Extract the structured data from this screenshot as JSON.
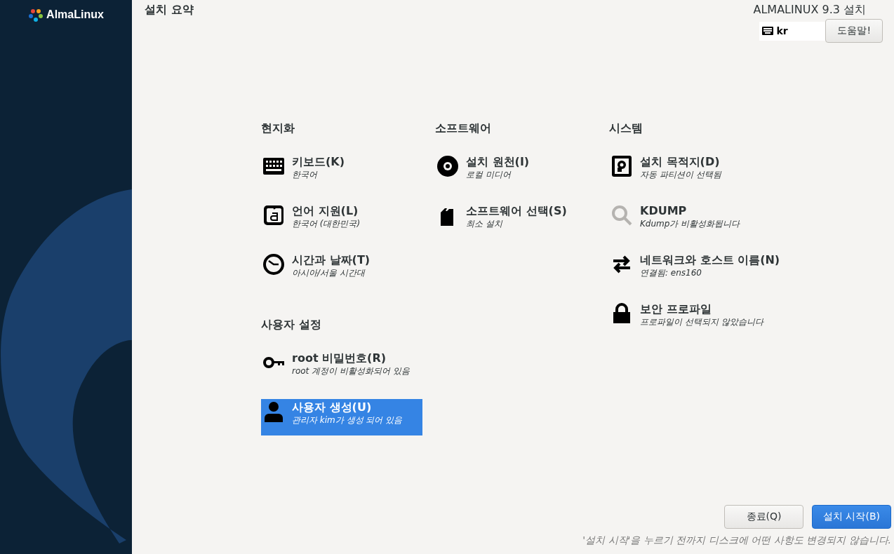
{
  "sidebar": {
    "logo_text": "AlmaLinux"
  },
  "header": {
    "title": "설치 요약",
    "product": "ALMALINUX 9.3 설치",
    "keyboard_layout": "kr",
    "help_button": "도움말!"
  },
  "columns": [
    {
      "sections": [
        {
          "title": "현지화",
          "items": [
            {
              "kind": "keyboard",
              "title": "키보드(K)",
              "status": "한국어",
              "selected": false,
              "disabled": false
            },
            {
              "kind": "language",
              "title": "언어 지원(L)",
              "status": "한국어 (대한민국)",
              "selected": false,
              "disabled": false
            },
            {
              "kind": "clock",
              "title": "시간과 날짜(T)",
              "status": "아시아/서울 시간대",
              "selected": false,
              "disabled": false
            }
          ]
        },
        {
          "title": "사용자 설정",
          "items": [
            {
              "kind": "key",
              "title": "root 비밀번호(R)",
              "status": "root 계정이 비활성화되어 있음",
              "selected": false,
              "disabled": false
            },
            {
              "kind": "user",
              "title": "사용자 생성(U)",
              "status": "관리자 kim가 생성 되어 있음",
              "selected": true,
              "disabled": false
            }
          ]
        }
      ]
    },
    {
      "sections": [
        {
          "title": "소프트웨어",
          "items": [
            {
              "kind": "disc",
              "title": "설치 원천(I)",
              "status": "로컬 미디어",
              "selected": false,
              "disabled": false
            },
            {
              "kind": "package",
              "title": "소프트웨어 선택(S)",
              "status": "최소 설치",
              "selected": false,
              "disabled": false
            }
          ]
        }
      ]
    },
    {
      "sections": [
        {
          "title": "시스템",
          "items": [
            {
              "kind": "disk",
              "title": "설치 목적지(D)",
              "status": "자동 파티션이 선택됨",
              "selected": false,
              "disabled": false
            },
            {
              "kind": "search",
              "title": "KDUMP",
              "status": "Kdump가 비활성화됩니다",
              "selected": false,
              "disabled": true
            },
            {
              "kind": "arrows",
              "title": "네트워크와 호스트 이름(N)",
              "status": "연결됨: ens160",
              "selected": false,
              "disabled": false
            },
            {
              "kind": "lock",
              "title": "보안 프로파일",
              "status": "프로파일이 선택되지 않았습니다",
              "selected": false,
              "disabled": false
            }
          ]
        }
      ]
    }
  ],
  "footer": {
    "buttons": [
      {
        "label": "종료(Q)",
        "kind": "secondary"
      },
      {
        "label": "설치 시작(B)",
        "kind": "primary"
      }
    ],
    "note": "'설치 시작'을 누르기 전까지 디스크에 어떤 사항도 변경되지 않습니다."
  }
}
